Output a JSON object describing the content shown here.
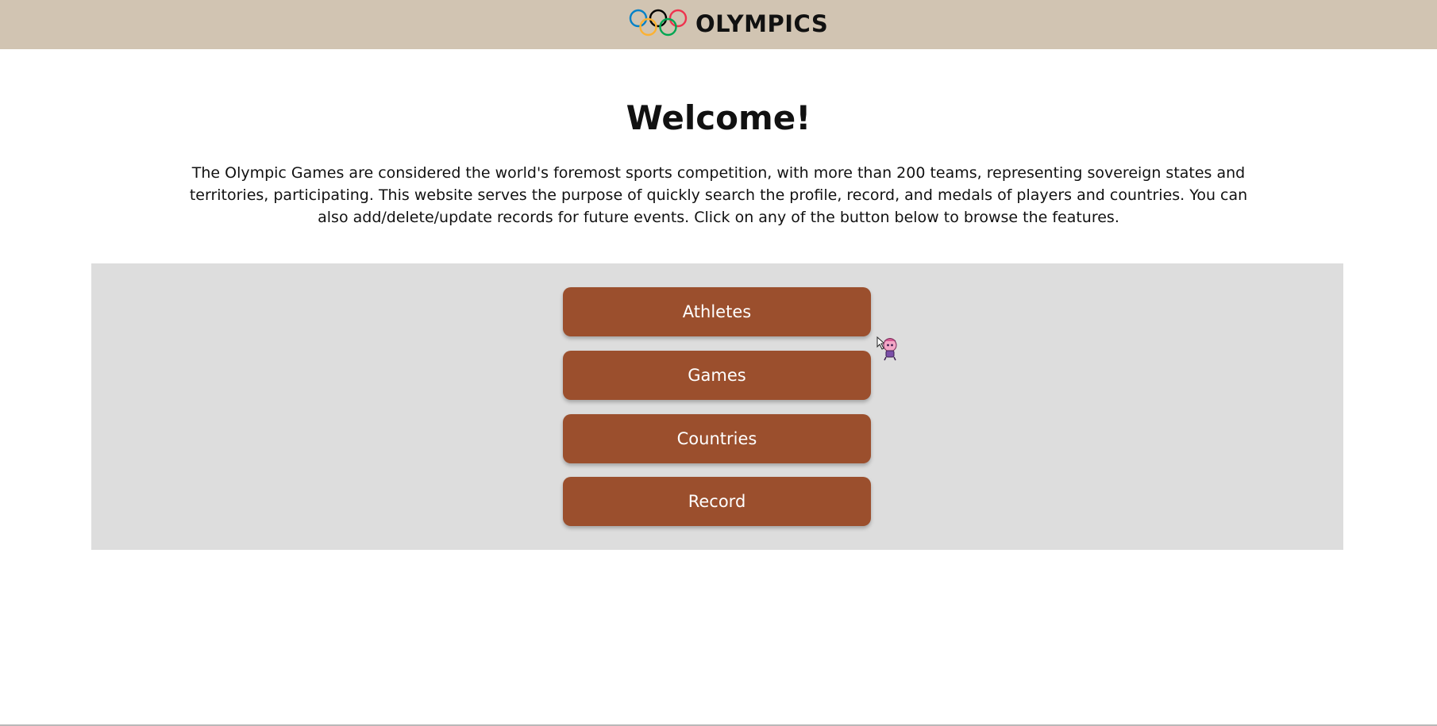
{
  "header": {
    "logo_icon": "olympic-rings-icon",
    "brand_text": "OLYMPICS",
    "background_color": "#d1c4b2"
  },
  "main": {
    "title": "Welcome!",
    "intro": "The Olympic Games are considered the world's foremost sports competition, with more than 200 teams, representing sovereign states and territories, participating. This website serves the purpose of quickly search the profile, record, and medals of players and countries. You can also add/delete/update records for future events. Click on any of the button below to browse the features."
  },
  "nav": {
    "panel_color": "#dddddd",
    "button_color": "#9b4f2d",
    "buttons": [
      {
        "label": "Athletes"
      },
      {
        "label": "Games"
      },
      {
        "label": "Countries"
      },
      {
        "label": "Record"
      }
    ]
  },
  "cursor": {
    "icon": "anime-character-cursor-icon"
  },
  "rings_colors": [
    "#0081c8",
    "#000000",
    "#ee334e",
    "#fcb131",
    "#00a651"
  ]
}
